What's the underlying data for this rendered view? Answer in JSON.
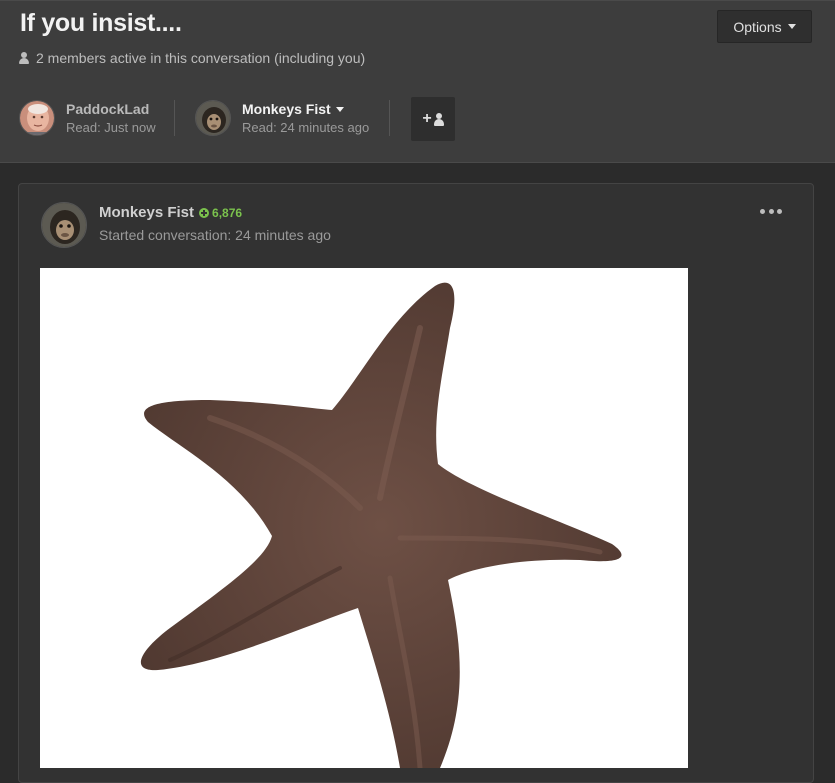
{
  "conversation": {
    "title": "If you insist....",
    "options_label": "Options",
    "members_active": "2 members active in this conversation (including you)"
  },
  "participants": [
    {
      "name": "PaddockLad",
      "read": "Read: Just now",
      "icon": "avatar-photo-man"
    },
    {
      "name": "Monkeys Fist",
      "read": "Read: 24 minutes ago",
      "icon": "avatar-photo-monkey"
    }
  ],
  "invite": {
    "icon": "add-user-icon"
  },
  "post": {
    "author": "Monkeys Fist",
    "reputation": "6,876",
    "started": "Started conversation: 24 minutes ago",
    "more_icon": "ellipsis-icon",
    "image_subject": "starfish-image"
  },
  "colors": {
    "header_bg": "#3d3d3d",
    "page_bg": "#2b2b2b",
    "reputation_green": "#7bc24d",
    "starfish_brown": "#5a3f35"
  }
}
